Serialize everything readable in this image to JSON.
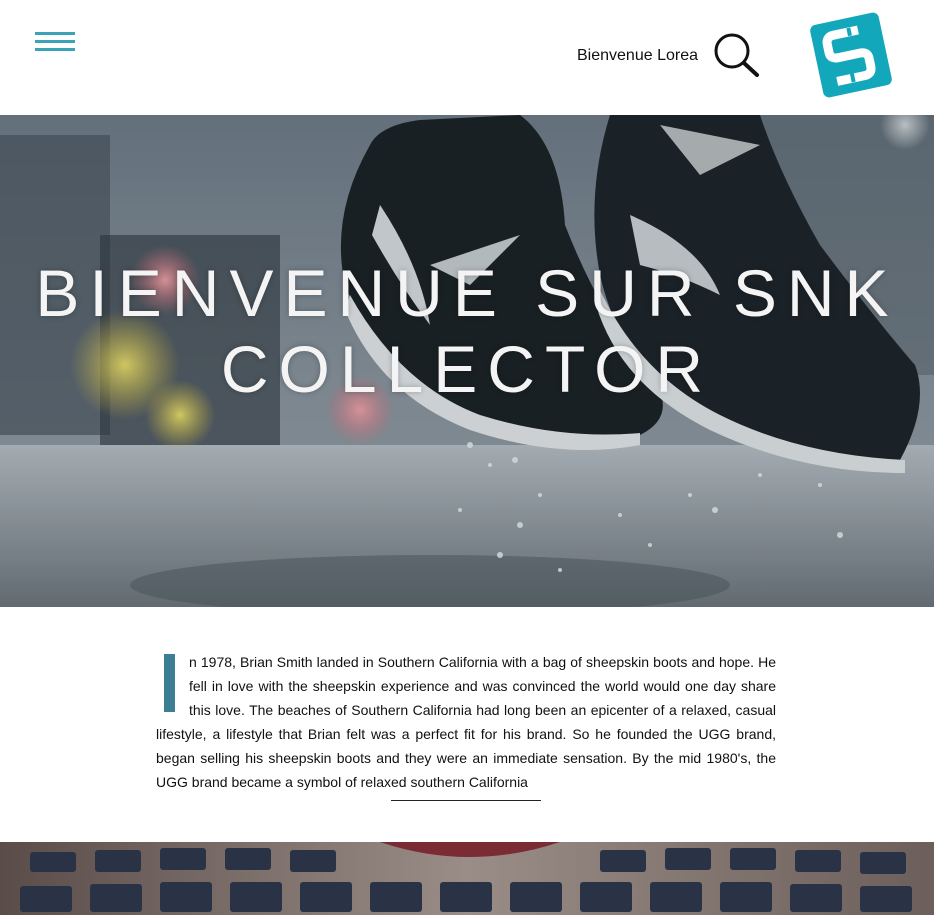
{
  "header": {
    "welcome_text": "Bienvenue Lorea",
    "logo_letter": "S"
  },
  "hero": {
    "title": "BIENVENUE SUR SNK COLLECTOR",
    "shoe_brand": "NIKE"
  },
  "article": {
    "dropcap_letter": "I",
    "body": "n 1978, Brian Smith landed in Southern California with a bag of sheepskin boots and hope. He fell in love with the sheepskin experience and was convinced the world would one day share this love. The beaches of Southern California had long been an epicenter of a relaxed, casual lifestyle, a lifestyle that Brian felt was a perfect fit for his brand. So he founded the UGG brand, began selling his sheepskin boots and they were an immediate sensation. By the mid 1980's, the UGG brand became a symbol of relaxed southern California"
  },
  "colors": {
    "accent": "#3aa3b5",
    "dropcap": "#3a7f92",
    "logo": "#13a7bb"
  },
  "icons": {
    "menu": "hamburger-menu-icon",
    "search": "search-icon",
    "logo": "brand-logo-icon"
  }
}
